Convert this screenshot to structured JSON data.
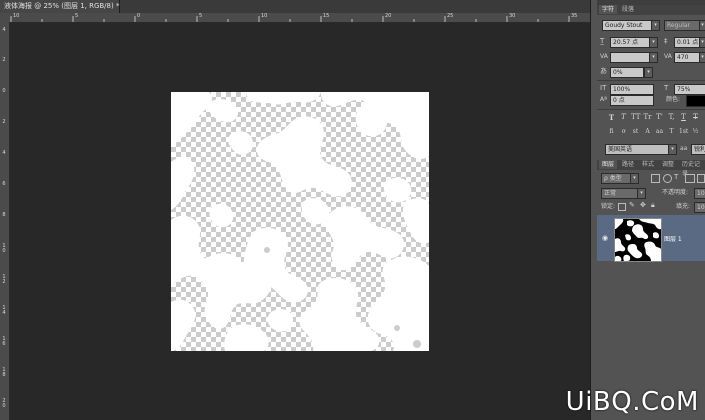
{
  "document": {
    "tab_title": "液体海报 @ 25% (图层 1, RGB/8) *",
    "close_glyph": "×"
  },
  "rulers": {
    "top_ticks": [
      "10",
      "5",
      "0",
      "5",
      "10",
      "15",
      "20",
      "25",
      "30",
      "35"
    ],
    "left_ticks": [
      "4",
      "2",
      "0",
      "2",
      "4",
      "6",
      "8",
      "1 0",
      "1 2",
      "1 4",
      "1 6",
      "1 8",
      "2 0"
    ]
  },
  "character_panel": {
    "tabs": [
      "字符",
      "段落"
    ],
    "font_family": "Goudy Stout",
    "font_style": "Regular",
    "font_size": "20.57 点",
    "leading": "0.01 点",
    "kerning": "",
    "tracking": "470",
    "scale_pct": "0%",
    "vertical_scale": "100%",
    "horizontal_scale": "75%",
    "baseline_shift": "0 点",
    "color_label": "颜色:",
    "style_buttons": [
      "T",
      "T",
      "TT",
      "Tr",
      "T'",
      "T,",
      "T",
      "T"
    ],
    "opentype_buttons": [
      "fi",
      "ơ",
      "st",
      "A",
      "aa",
      "T",
      "1st",
      "½"
    ],
    "language": "美国英语",
    "antialias": "锐利"
  },
  "layers_panel": {
    "tabs": [
      "图层",
      "路径",
      "样式",
      "调整",
      "历史记录"
    ],
    "filter_kind": "类型",
    "blend_mode": "正常",
    "opacity_label": "不透明度:",
    "opacity_value": "100",
    "lock_label": "锁定:",
    "fill_label": "填充:",
    "fill_value": "100",
    "layers": [
      {
        "name": "图层 1",
        "visible": true,
        "selected": true
      }
    ]
  },
  "watermark": "UiBQ.CoM",
  "colors": {
    "workspace": "#282828",
    "panel": "#535353",
    "selected_layer": "#5a6a82"
  }
}
